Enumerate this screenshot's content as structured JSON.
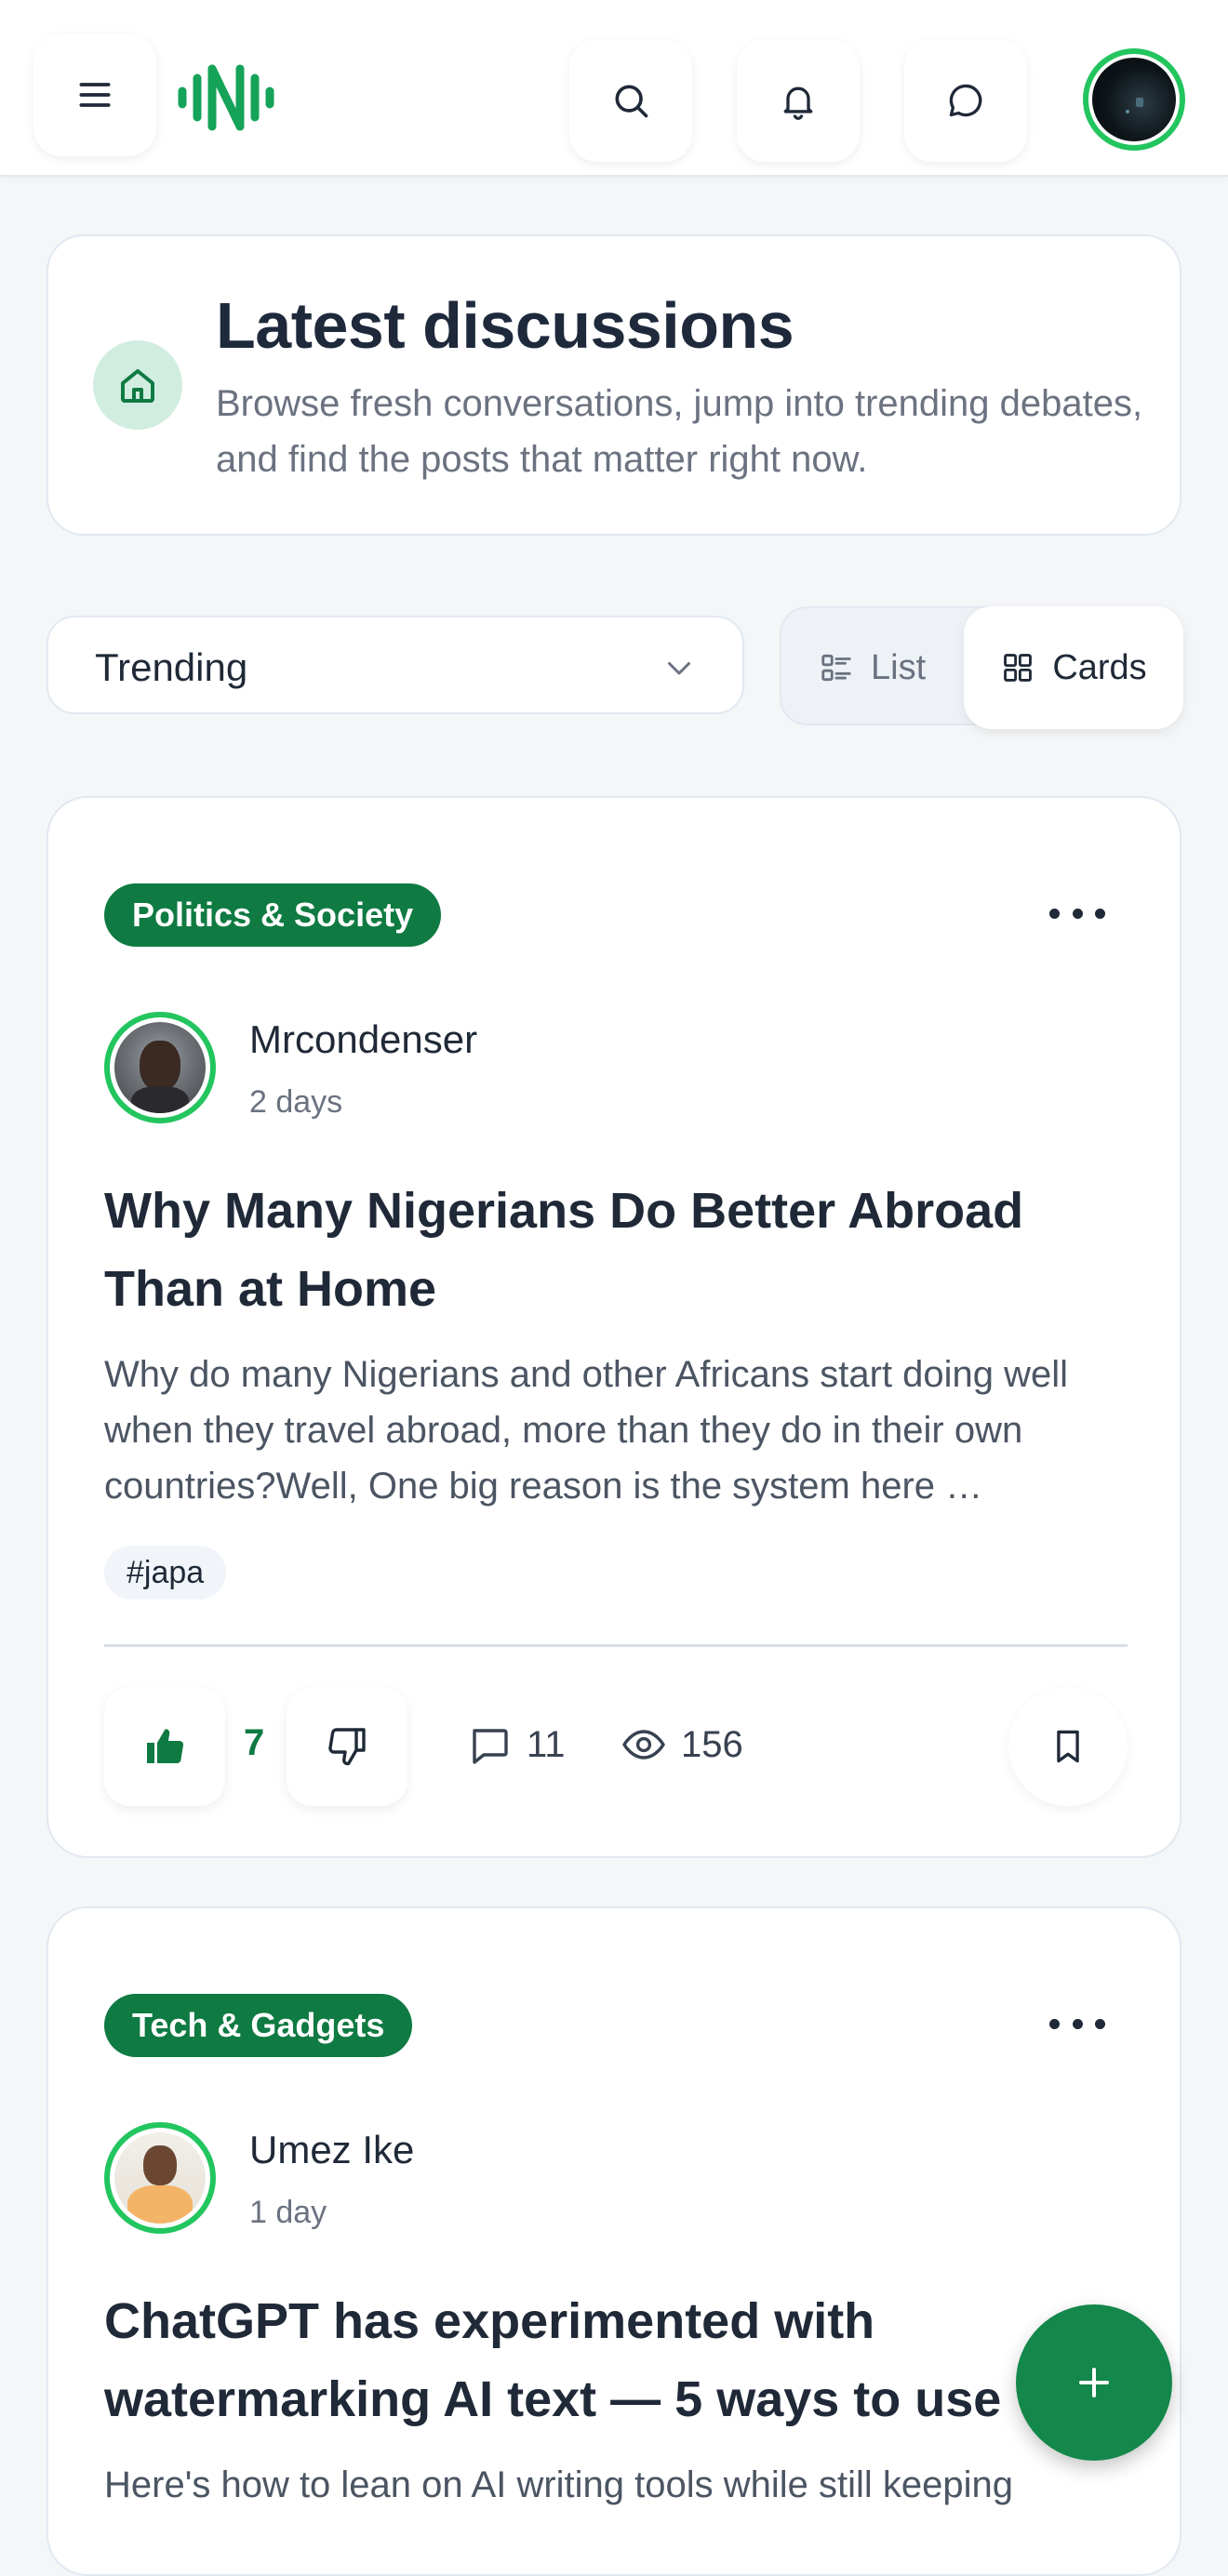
{
  "header": {
    "menu_icon": "hamburger-icon",
    "logo_icon": "brand-logo-icon",
    "search_icon": "search-icon",
    "notifications_icon": "bell-icon",
    "messages_icon": "chat-bubble-icon",
    "accent_color": "#22c55e"
  },
  "hero": {
    "icon": "home-icon",
    "title": "Latest discussions",
    "subtitle": "Browse fresh conversations, jump into trending debates, and find the posts that matter right now."
  },
  "controls": {
    "sort_selected": "Trending",
    "view_list_label": "List",
    "view_cards_label": "Cards",
    "active_view": "Cards"
  },
  "posts": [
    {
      "category": "Politics & Society",
      "author": "Mrcondenser",
      "time": "2 days",
      "title": "Why Many Nigerians Do Better Abroad Than at Home",
      "excerpt": "Why do many Nigerians and other Africans start doing well when they travel abroad, more than they do in their own countries?Well, One big reason is the system here …",
      "tag": "#japa",
      "likes": "7",
      "liked": true,
      "comments": "11",
      "views": "156"
    },
    {
      "category": "Tech & Gadgets",
      "author": "Umez Ike",
      "time": "1 day",
      "title": "ChatGPT has experimented with watermarking AI text — 5 ways to use",
      "excerpt": "Here's how to lean on AI writing tools while still keeping"
    }
  ],
  "colors": {
    "brand_green": "#0f7a42",
    "fab_green": "#14874a",
    "avatar_ring": "#22c55e"
  },
  "fab": {
    "icon": "plus-icon"
  }
}
